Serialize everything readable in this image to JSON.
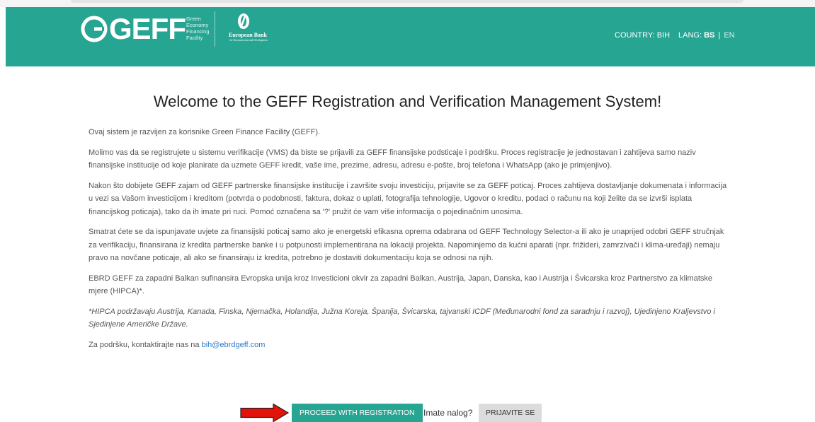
{
  "header": {
    "brand": "GEFF",
    "brand_sub": [
      "Green",
      "Economy",
      "Financing",
      "Facility"
    ],
    "ebrd_name": "European Bank",
    "ebrd_sub": "for Reconstruction and Development",
    "country_label": "COUNTRY: BIH",
    "lang_prefix": "LANG:",
    "lang_active": "BS",
    "lang_sep": "|",
    "lang_other": "EN"
  },
  "main": {
    "title": "Welcome to the GEFF Registration and Verification Management System!",
    "p1": "Ovaj sistem je razvijen za korisnike Green Finance Facility (GEFF).",
    "p2": "Molimo vas da se registrujete u sistemu verifikacije (VMS) da biste se prijavili za GEFF finansijske podsticaje i podršku. Proces registracije je jednostavan i zahtijeva samo naziv finansijske institucije od koje planirate da uzmete GEFF kredit, vaše ime, prezime, adresu, adresu e-pošte, broj telefona i WhatsApp (ako je primjenjivo).",
    "p3": "Nakon što dobijete GEFF zajam od GEFF partnerske finansijske institucije i završite svoju investiciju, prijavite se za GEFF poticaj. Proces zahtijeva dostavljanje dokumenata i informacija u vezi sa Vašom investicijom i kreditom (potvrda o podobnosti, faktura, dokaz o uplati, fotografija tehnologije, Ugovor o kreditu, podaci o računu na koji želite da se izvrši isplata financijskog poticaja), tako da ih imate pri ruci. Pomoć označena sa '?' pružit će vam više informacija o pojedinačnim unosima.",
    "p4": "Smatrat ćete se da ispunjavate uvjete za finansijski poticaj samo ako je energetski efikasna oprema odabrana od GEFF Technology Selector-a ili ako je unaprijed odobri GEFF stručnjak za verifikaciju, finansirana iz kredita partnerske banke i u potpunosti implementirana na lokaciji projekta. Napominjemo da kućni aparati (npr. frižideri, zamrzivači i klima-uređaji) nemaju pravo na novčane poticaje, ali ako se finansiraju iz kredita, potrebno je dostaviti dokumentaciju koja se odnosi na njih.",
    "p5": "EBRD GEFF za zapadni Balkan sufinansira Evropska unija kroz Investicioni okvir za zapadni Balkan, Austrija, Japan, Danska, kao i Austrija i Švicarska kroz Partnerstvo za klimatske mjere (HIPCA)*.",
    "note": "*HIPCA podržavaju Austrija, Kanada, Finska, Njemačka, Holandija, Južna Koreja, Španija, Švicarska, tajvanski ICDF (Međunarodni fond za saradnju i razvoj), Ujedinjeno Kraljevstvo i Sjedinjene Američke Države.",
    "support_text": "Za podršku, kontaktirajte nas na ",
    "support_email": "bih@ebrdgeff.com"
  },
  "actions": {
    "proceed_label": "PROCEED WITH REGISTRATION",
    "have_account": "Imate nalog?",
    "login_label": "PRIJAVITE SE"
  },
  "icons": {
    "logo": "geff-g-icon",
    "ebrd": "ebrd-emblem-icon",
    "arrow": "red-arrow-icon"
  },
  "colors": {
    "header": "#27a593",
    "link": "#2b77c9",
    "arrow": "#e3120b",
    "login_bg": "#dcdcdc"
  }
}
